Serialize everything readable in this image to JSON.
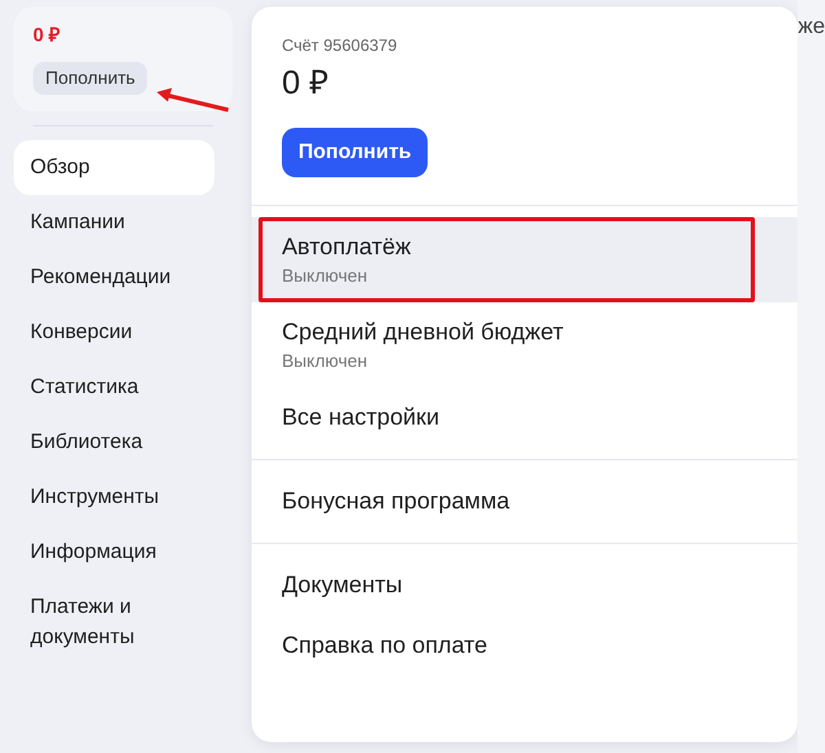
{
  "sidebar": {
    "balance": "0 ₽",
    "topup_button": {
      "label": "Пополнить",
      "arrow_annotation": true
    },
    "nav": [
      {
        "label": "Обзор",
        "selected": true
      },
      {
        "label": "Кампании",
        "selected": false
      },
      {
        "label": "Рекомендации",
        "selected": false
      },
      {
        "label": "Конверсии",
        "selected": false
      },
      {
        "label": "Статистика",
        "selected": false
      },
      {
        "label": "Библиотека",
        "selected": false
      },
      {
        "label": "Инструменты",
        "selected": false
      },
      {
        "label": "Информация",
        "selected": false
      },
      {
        "label": "Платежи и документы",
        "selected": false
      }
    ]
  },
  "background_text": "же",
  "panel": {
    "account": "Счёт 95606379",
    "balance": "0 ₽",
    "topup_button": "Пополнить",
    "groups": [
      [
        {
          "label": "Автоплатёж",
          "subtitle": "Выключен",
          "selected": true,
          "outlined": true
        },
        {
          "label": "Средний дневной бюджет",
          "subtitle": "Выключен",
          "selected": false,
          "outlined": false
        },
        {
          "label": "Все настройки",
          "selected": false,
          "outlined": false
        }
      ],
      [
        {
          "label": "Бонусная программа",
          "selected": false,
          "outlined": false
        }
      ],
      [
        {
          "label": "Документы",
          "selected": false,
          "outlined": false
        },
        {
          "label": "Справка по оплате",
          "selected": false,
          "outlined": false
        }
      ]
    ]
  }
}
